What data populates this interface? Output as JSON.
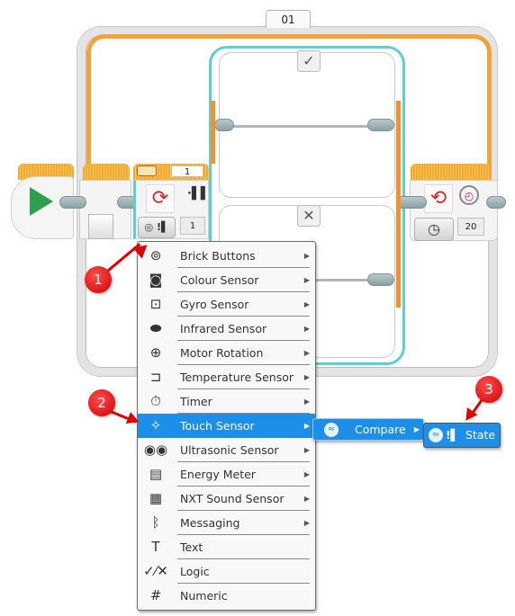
{
  "loop": {
    "name_label": "01",
    "count_value": "20",
    "mode_icon": "timer-icon"
  },
  "switch": {
    "true_case_icon": "✓",
    "false_case_icon": "✕",
    "header_value": "1",
    "port_value": "1"
  },
  "start_block": {
    "icon": "play-icon"
  },
  "sensor_menu": {
    "items": [
      {
        "label": "Brick Buttons",
        "icon": "brick-buttons-icon",
        "glyph": "⊚",
        "has_submenu": true
      },
      {
        "label": "Colour Sensor",
        "icon": "colour-sensor-icon",
        "glyph": "◙",
        "has_submenu": true
      },
      {
        "label": "Gyro Sensor",
        "icon": "gyro-sensor-icon",
        "glyph": "⊡",
        "has_submenu": true
      },
      {
        "label": "Infrared Sensor",
        "icon": "infrared-sensor-icon",
        "glyph": "⬬",
        "has_submenu": true
      },
      {
        "label": "Motor Rotation",
        "icon": "motor-rotation-icon",
        "glyph": "⊕",
        "has_submenu": true
      },
      {
        "label": "Temperature Sensor",
        "icon": "temperature-sensor-icon",
        "glyph": "⊐",
        "has_submenu": true
      },
      {
        "label": "Timer",
        "icon": "timer-icon",
        "glyph": "⏱",
        "has_submenu": true
      },
      {
        "label": "Touch Sensor",
        "icon": "touch-sensor-icon",
        "glyph": "✧",
        "has_submenu": true,
        "active": true
      },
      {
        "label": "Ultrasonic Sensor",
        "icon": "ultrasonic-sensor-icon",
        "glyph": "◉◉",
        "has_submenu": true
      },
      {
        "label": "Energy Meter",
        "icon": "energy-meter-icon",
        "glyph": "▤",
        "has_submenu": true
      },
      {
        "label": "NXT Sound Sensor",
        "icon": "nxt-sound-sensor-icon",
        "glyph": "▦",
        "has_submenu": true
      },
      {
        "label": "Messaging",
        "icon": "bluetooth-icon",
        "glyph": "ᛒ",
        "has_submenu": true
      },
      {
        "label": "Text",
        "icon": "text-icon",
        "glyph": "T",
        "has_submenu": false
      },
      {
        "label": "Logic",
        "icon": "logic-icon",
        "glyph": "✓⁄✕",
        "has_submenu": false
      },
      {
        "label": "Numeric",
        "icon": "numeric-icon",
        "glyph": "#",
        "has_submenu": false
      }
    ],
    "arrow_glyph": "▶"
  },
  "submenu_compare": {
    "label": "Compare",
    "icon": "compare-icon",
    "arrow_glyph": "▶"
  },
  "submenu_state": {
    "label": "State",
    "icon": "compare-icon"
  },
  "annotations": [
    {
      "number": "1",
      "color": "#e00000"
    },
    {
      "number": "2",
      "color": "#e00000"
    },
    {
      "number": "3",
      "color": "#e00000"
    }
  ],
  "colors": {
    "loop_orange": "#f4a33a",
    "switch_teal": "#5bd0cf",
    "menu_highlight": "#1e8fe8",
    "start_green": "#2e9e4f",
    "badge_red": "#e00000"
  }
}
